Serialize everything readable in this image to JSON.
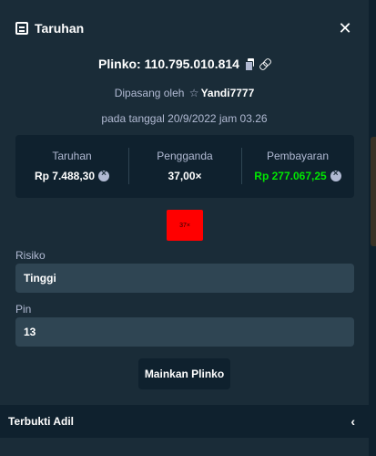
{
  "modal": {
    "title": "Taruhan",
    "close_icon": "close-icon"
  },
  "game": {
    "name_id": "Plinko: 110.795.010.814",
    "copy_icon": "copy-icon",
    "link_icon": "link-icon"
  },
  "placed": {
    "prefix": "Dipasang oleh",
    "user": "Yandi7777",
    "date": "pada tanggal 20/9/2022 jam 03.26"
  },
  "stats": {
    "bet_label": "Taruhan",
    "bet_value": "Rp 7.488,30",
    "multiplier_label": "Pengganda",
    "multiplier_value": "37,00×",
    "payout_label": "Pembayaran",
    "payout_value": "Rp 277.067,25"
  },
  "result": {
    "multiplier_tile": "37×",
    "tile_color": "#ff0000"
  },
  "form": {
    "risk_label": "Risiko",
    "risk_value": "Tinggi",
    "pins_label": "Pin",
    "pins_value": "13"
  },
  "actions": {
    "play_label": "Mainkan Plinko"
  },
  "footer": {
    "label": "Terbukti Adil",
    "chevron_icon": "chevron-left-icon"
  },
  "colors": {
    "background": "#1a2c38",
    "panel": "#0f212e",
    "field": "#2f4553",
    "muted_text": "#b1bad3",
    "win_green": "#00e701"
  }
}
